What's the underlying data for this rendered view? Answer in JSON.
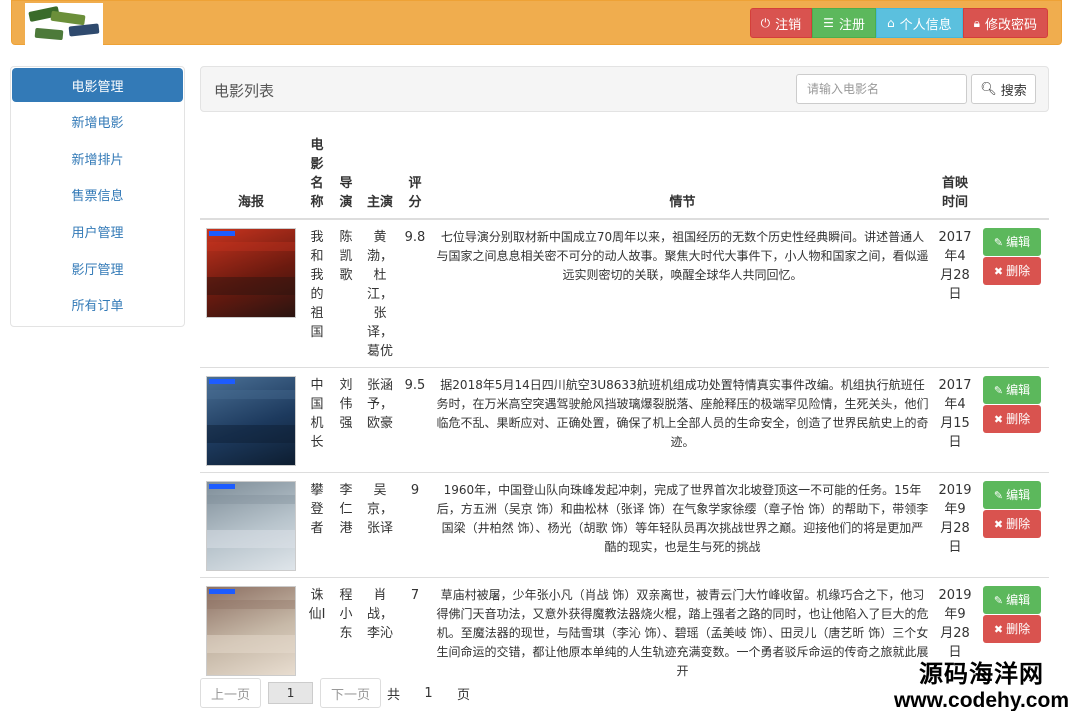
{
  "header": {
    "logo_icon": "film-strip-logo",
    "buttons": [
      {
        "label": "注销",
        "icon": "power-icon",
        "style": "danger"
      },
      {
        "label": "注册",
        "icon": "list-icon",
        "style": "success"
      },
      {
        "label": "个人信息",
        "icon": "home-icon",
        "style": "info"
      },
      {
        "label": "修改密码",
        "icon": "lock-icon",
        "style": "danger"
      }
    ]
  },
  "sidebar": {
    "items": [
      {
        "label": "电影管理",
        "active": true
      },
      {
        "label": "新增电影"
      },
      {
        "label": "新增排片"
      },
      {
        "label": "售票信息"
      },
      {
        "label": "用户管理"
      },
      {
        "label": "影厅管理"
      },
      {
        "label": "所有订单"
      }
    ]
  },
  "panel": {
    "title": "电影列表",
    "search_placeholder": "请输入电影名",
    "search_label": "搜索"
  },
  "table": {
    "headers": {
      "poster": "海报",
      "name": "电影名称",
      "director": "导演",
      "actors": "主演",
      "rating": "评分",
      "plot": "情节",
      "date": "首映时间"
    },
    "edit_label": "编辑",
    "delete_label": "删除",
    "rows": [
      {
        "name": "我和我的祖国",
        "director": "陈凯歌",
        "actors": "黄渤，杜江，张译，葛优",
        "rating": "9.8",
        "plot": "七位导演分别取材新中国成立70周年以来，祖国经历的无数个历史性经典瞬间。讲述普通人与国家之间息息相关密不可分的动人故事。聚焦大时代大事件下，小人物和国家之间，看似遥远实则密切的关联，唤醒全球华人共同回忆。",
        "date": "2017年4月28日",
        "poster_colors": [
          "#6b1a0f",
          "#c8341f",
          "#2a1410"
        ]
      },
      {
        "name": "中国机长",
        "director": "刘伟强",
        "actors": "张涵予，欧豪",
        "rating": "9.5",
        "plot": "据2018年5月14日四川航空3U8633航班机组成功处置特情真实事件改编。机组执行航班任务时，在万米高空突遇驾驶舱风挡玻璃爆裂脱落、座舱释压的极端罕见险情，生死关头，他们临危不乱、果断应对、正确处置，确保了机上全部人员的生命安全，创造了世界民航史上的奇迹。",
        "date": "2017年4月15日",
        "poster_colors": [
          "#1d3a5e",
          "#4a6f94",
          "#0d1d30"
        ]
      },
      {
        "name": "攀登者",
        "director": "李仁港",
        "actors": "吴京，张译",
        "rating": "9",
        "plot": "1960年，中国登山队向珠峰发起冲刺，完成了世界首次北坡登顶这一不可能的任务。15年后，方五洲（吴京 饰）和曲松林（张译 饰）在气象学家徐缨（章子怡 饰）的帮助下，带领李国梁（井柏然 饰）、杨光（胡歌 饰）等年轻队员再次挑战世界之巅。迎接他们的将是更加严酷的现实，也是生与死的挑战",
        "date": "2019年9月28日",
        "poster_colors": [
          "#b8c4cc",
          "#7e8d98",
          "#dfe5ea"
        ]
      },
      {
        "name": "诛仙Ⅰ",
        "director": "程小东",
        "actors": "肖战，李沁",
        "rating": "7",
        "plot": "草庙村被屠，少年张小凡（肖战 饰）双亲离世，被青云门大竹峰收留。机缘巧合之下，他习得佛门天音功法，又意外获得魔教法器烧火棍，踏上强者之路的同时，也让他陷入了巨大的危机。至魔法器的现世，与陆雪琪（李沁 饰）、碧瑶（孟美岐 饰）、田灵儿（唐艺昕 饰）三个女生间命运的交错，都让他原本单纯的人生轨迹充满变数。一个勇者驳斥命运的传奇之旅就此展开",
        "date": "2019年9月28日",
        "poster_colors": [
          "#c7b9a8",
          "#8c6f62",
          "#e8ddd0"
        ]
      }
    ]
  },
  "pagination": {
    "prev_label": "上一页",
    "current_page": "1",
    "next_label": "下一页",
    "total_prefix": "共",
    "total_pages": "1",
    "total_suffix": "页"
  },
  "watermark": {
    "line1": "源码海洋网",
    "line2": "www.codehy.com"
  }
}
